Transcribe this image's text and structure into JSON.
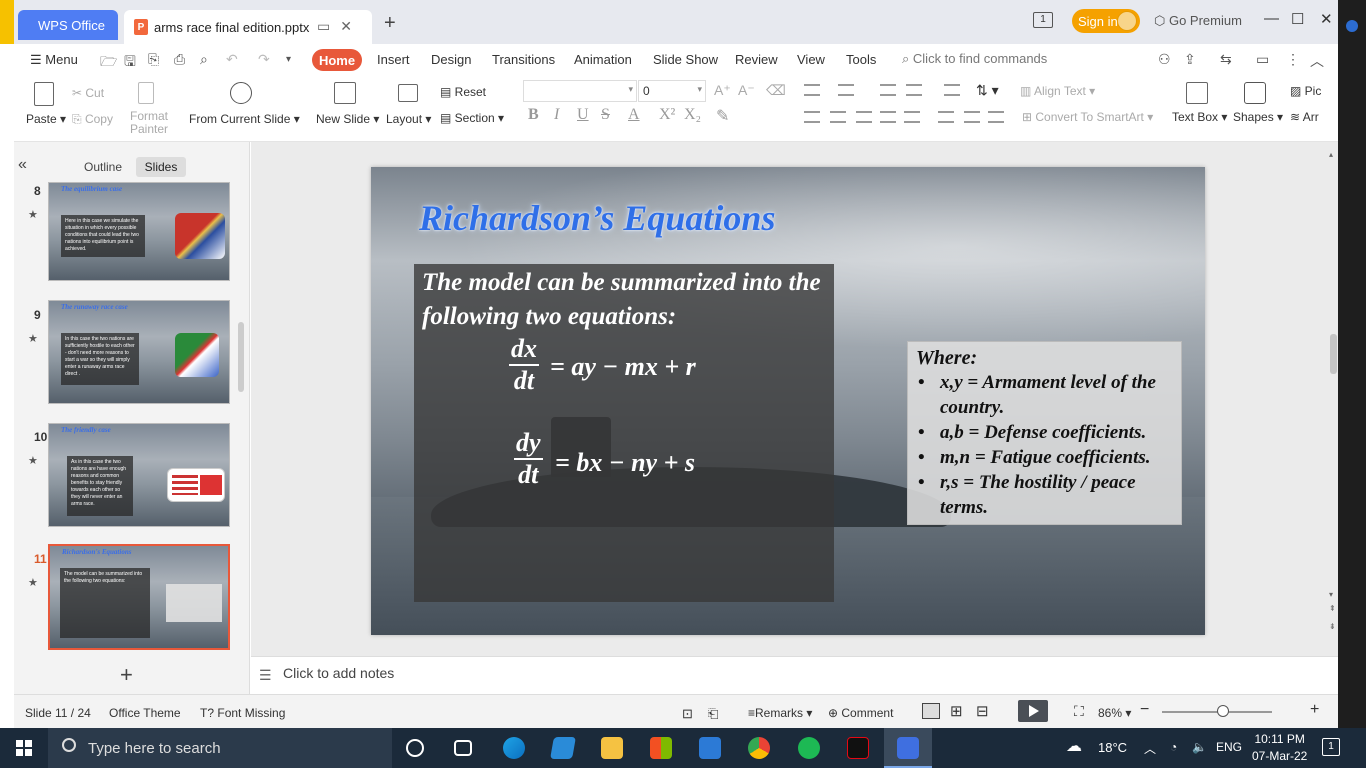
{
  "titlebar": {
    "app_tab": "WPS Office",
    "doc_tab": "arms race final edition.pptx",
    "new_tab": "+",
    "sign_in": "Sign in",
    "go_premium": "Go Premium",
    "page_badge": "1"
  },
  "menu": {
    "menu_label": "Menu",
    "tabs": [
      "Home",
      "Insert",
      "Design",
      "Transitions",
      "Animation",
      "Slide Show",
      "Review",
      "View",
      "Tools"
    ],
    "find_commands": "Click to find commands"
  },
  "ribbon": {
    "paste": "Paste",
    "cut": "Cut",
    "copy": "Copy",
    "format_painter": "Format\nPainter",
    "from_current_slide": "From Current Slide",
    "new_slide": "New Slide",
    "layout": "Layout",
    "reset": "Reset",
    "section": "Section",
    "font_name_value": "",
    "font_size_value": "0",
    "align_text": "Align Text",
    "convert_smartart": "Convert To SmartArt",
    "text_box": "Text Box",
    "shapes": "Shapes",
    "picture": "Pic",
    "arrange": "Arr"
  },
  "left_panel": {
    "outline_tab": "Outline",
    "slides_tab": "Slides",
    "slides": [
      {
        "number": "8",
        "title": "The equilibrium case",
        "body": "Here in this case we simulate the situation in which every possible conditions that could lead the two nations into equilibrium point is achieved."
      },
      {
        "number": "9",
        "title": "The runaway race case",
        "body": "In this case the two nations are sufficiently hostile to each other - don't need more reasons to start a war so they will simply enter a runaway arms race direct ."
      },
      {
        "number": "10",
        "title": "The friendly case",
        "body": "As in this case the two nations are have enough reasons and common benefits to stay friendly towards each other so they will never enter an arms race."
      },
      {
        "number": "11",
        "title": "Richardson's Equations",
        "body": "The model can be summarized into the following two equations:"
      }
    ],
    "current_slide_index": 3
  },
  "slide": {
    "title": "Richardson’s Equations",
    "intro": "The model can be summarized into the following two equations:",
    "eq1": {
      "num": "dx",
      "den": "dt",
      "rhs": "= ay − mx + r"
    },
    "eq2": {
      "num": "dy",
      "den": "dt",
      "rhs": "= bx − ny + s"
    },
    "where_title": "Where:",
    "where_items": [
      "x,y = Armament level of the country.",
      "a,b = Defense coefficients.",
      "m,n = Fatigue coefficients.",
      "r,s = The hostility / peace terms."
    ]
  },
  "notes": {
    "placeholder": "Click to add notes"
  },
  "status": {
    "slide_counter": "Slide 11 / 24",
    "theme": "Office Theme",
    "font_missing": "Font Missing",
    "remarks": "Remarks",
    "comment": "Comment",
    "zoom": "86%",
    "zoom_fraction": 0.55
  },
  "taskbar": {
    "search_placeholder": "Type here to search",
    "weather": "18°C",
    "language": "ENG",
    "time": "10:11 PM",
    "date": "07-Mar-22",
    "notifications": "1"
  },
  "colors": {
    "accent": "#e8583a",
    "wps_blue": "#4f7df3",
    "slide_title": "#2f6fe8",
    "signin": "#f5a100"
  }
}
